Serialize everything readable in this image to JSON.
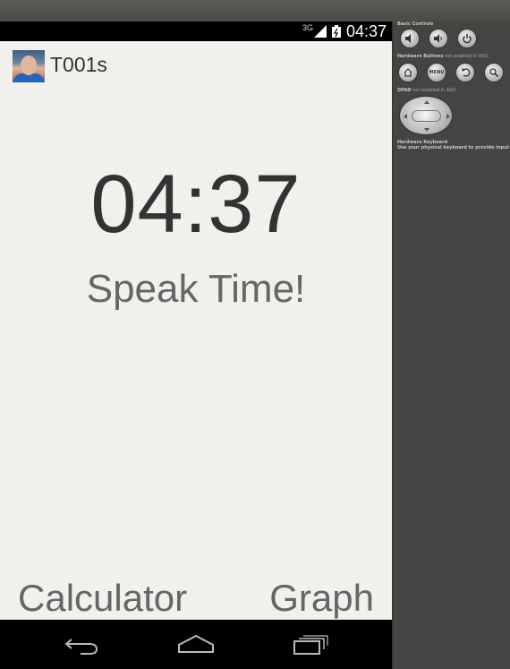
{
  "status_bar": {
    "network": "3G",
    "time": "04:37"
  },
  "app": {
    "title": "T001s",
    "clock": "04:37",
    "speak_label": "Speak Time!",
    "calculator_label": "Calculator",
    "graph_label": "Graph"
  },
  "emulator_panel": {
    "basic_controls": "Basic Controls",
    "hardware_buttons": "Hardware Buttons",
    "hardware_buttons_note": "not enabled in AVD",
    "menu_label": "MENU",
    "dpad": "DPAD",
    "dpad_note": "not enabled in AVD",
    "hardware_keyboard": "Hardware Keyboard",
    "keyboard_note": "Use your physical keyboard to provide input"
  }
}
